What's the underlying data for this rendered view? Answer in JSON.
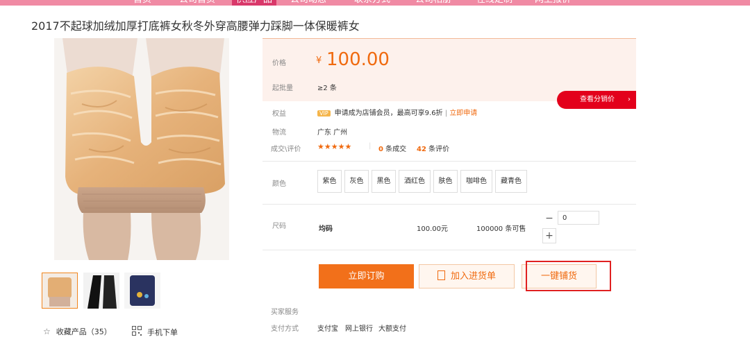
{
  "topnav": {
    "items": [
      {
        "label": "首页"
      },
      {
        "label": "公司首页"
      },
      {
        "label": "供应产品"
      },
      {
        "label": "公司动态"
      },
      {
        "label": "联系方式"
      },
      {
        "label": "公司相册"
      },
      {
        "label": "在线定制"
      },
      {
        "label": "网上报价"
      }
    ]
  },
  "product": {
    "title": "2017不起球加绒加厚打底裤女秋冬外穿高腰弹力踩脚一体保暖裤女"
  },
  "gallery": {
    "collect_label": "收藏产品（35）",
    "mobile_label": "手机下单"
  },
  "price_section": {
    "price_label": "价格",
    "currency": "¥",
    "price": "100.00",
    "moq_label": "起批量",
    "moq_value": "≥2 条",
    "distribution_button": "查看分销价",
    "chevron": "›"
  },
  "info": {
    "rights_label": "权益",
    "vip_badge": "VIP",
    "rights_text": "申请成为店铺会员，最高可享9.6折",
    "rights_sep": "|",
    "rights_link": "立即申请",
    "logistics_label": "物流",
    "logistics_value": "广东 广州",
    "deals_label": "成交\\评价",
    "rating": 4.5,
    "stars": "★★★★★",
    "deals_count": "0",
    "deals_text": "条成交",
    "review_count": "42",
    "review_text": "条评价"
  },
  "color": {
    "label": "颜色",
    "options": [
      "紫色",
      "灰色",
      "黑色",
      "酒红色",
      "肤色",
      "咖啡色",
      "藏青色"
    ]
  },
  "size": {
    "label": "尺码",
    "name": "均码",
    "price": "100.00元",
    "stock": "100000 条可售",
    "quantity": "0",
    "minus": "−",
    "plus": "+"
  },
  "actions": {
    "buy_now": "立即订购",
    "add_to_cart": "加入进货单",
    "one_click": "一键铺货"
  },
  "services": {
    "buyer_label": "买家服务",
    "payment_label": "支付方式",
    "payment_methods": [
      "支付宝",
      "网上银行",
      "大额支付"
    ]
  },
  "colors": {
    "accent": "#f06a0f",
    "button_orange": "#f2701a",
    "distribution_red": "#e3001b",
    "nav_pink": "#f08aa4",
    "highlight_red": "#e02020"
  }
}
